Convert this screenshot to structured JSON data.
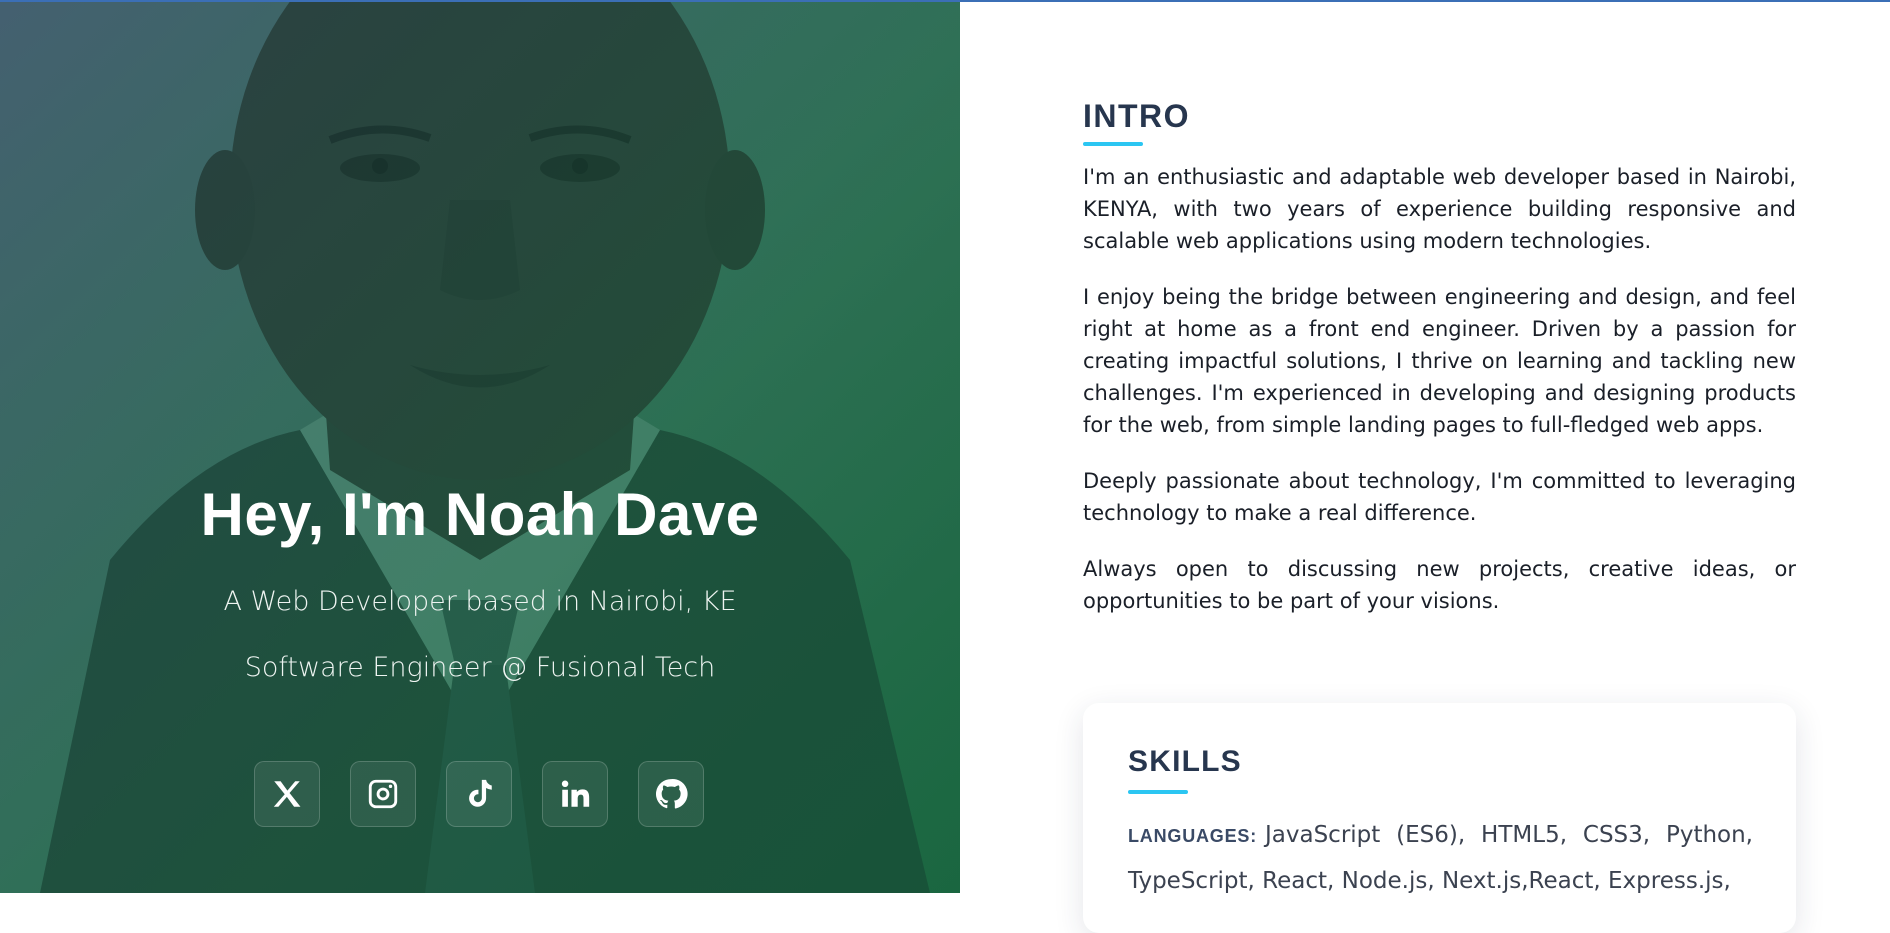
{
  "hero": {
    "title": "Hey, I'm Noah Dave",
    "subtitle": "A Web Developer based in Nairobi, KE",
    "role": "Software Engineer @ Fusional Tech",
    "socials": [
      {
        "name": "x",
        "icon": "x-icon"
      },
      {
        "name": "instagram",
        "icon": "instagram-icon"
      },
      {
        "name": "tiktok",
        "icon": "tiktok-icon"
      },
      {
        "name": "linkedin",
        "icon": "linkedin-icon"
      },
      {
        "name": "github",
        "icon": "github-icon"
      }
    ]
  },
  "intro": {
    "heading": "INTRO",
    "paragraphs": [
      "I'm an enthusiastic and adaptable web developer based in Nairobi, KENYA, with two years of experience building responsive and scalable web applications using modern technologies.",
      "I enjoy being the bridge between engineering and design, and feel right at home as a front end engineer. Driven by a passion for creating impactful solutions, I thrive on learning and tackling new challenges. I'm experienced in developing and designing products for the web, from simple landing pages to full-fledged web apps.",
      "Deeply passionate about technology, I'm committed to leveraging technology to make a real difference.",
      "Always open to discussing new projects, creative ideas, or opportunities to be part of your visions."
    ]
  },
  "skills": {
    "heading": "SKILLS",
    "languages_label": "LANGUAGES:",
    "languages_value": "JavaScript (ES6), HTML5, CSS3, Python, TypeScript, React, Node.js, Next.js,React, Express.js,"
  },
  "colors": {
    "accent": "#2bc6f2",
    "heading": "#27364e",
    "hero_green": "#1f6a44"
  }
}
